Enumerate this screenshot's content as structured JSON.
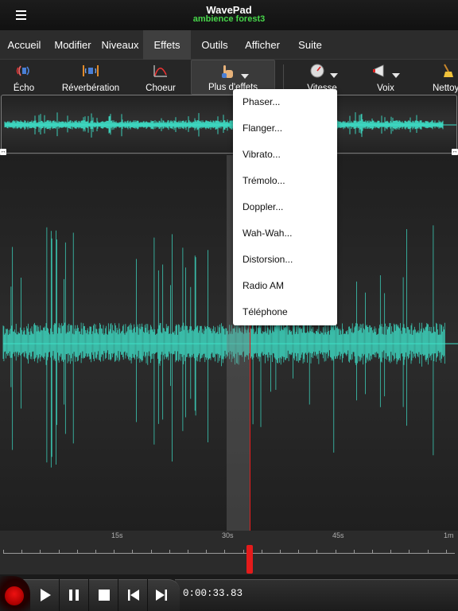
{
  "app": {
    "title": "WavePad",
    "file_name": "ambience forest3"
  },
  "colors": {
    "waveform": "#3ee0c8",
    "file_name": "#47d64a",
    "playhead": "#e31d1d"
  },
  "tabs": [
    {
      "label": "Accueil"
    },
    {
      "label": "Modifier"
    },
    {
      "label": "Niveaux"
    },
    {
      "label": "Effets",
      "active": true
    },
    {
      "label": "Outils"
    },
    {
      "label": "Afficher"
    },
    {
      "label": "Suite"
    }
  ],
  "toolbar": {
    "echo": {
      "label": "Écho",
      "icon": "echo-icon"
    },
    "reverb": {
      "label": "Réverbération",
      "icon": "reverb-icon"
    },
    "chorus": {
      "label": "Choeur",
      "icon": "chorus-icon"
    },
    "more": {
      "label": "Plus d'effets",
      "icon": "hand-icon"
    },
    "speed": {
      "label": "Vitesse",
      "icon": "speedometer-icon"
    },
    "voice": {
      "label": "Voix",
      "icon": "megaphone-icon"
    },
    "clean": {
      "label": "Nettoy",
      "icon": "broom-icon"
    }
  },
  "effects_menu": {
    "items": [
      "Phaser...",
      "Flanger...",
      "Vibrato...",
      "Trémolo...",
      "Doppler...",
      "Wah-Wah...",
      "Distorsion...",
      "Radio AM",
      "Téléphone"
    ]
  },
  "timeline": {
    "labels": [
      "15s",
      "30s",
      "45s",
      "1m"
    ],
    "playhead_time": "0:00:33.83"
  },
  "transport": {
    "record": "record-icon",
    "play": "play-icon",
    "pause": "pause-icon",
    "stop": "stop-icon",
    "previous": "skip-back-icon",
    "next": "skip-forward-icon"
  }
}
